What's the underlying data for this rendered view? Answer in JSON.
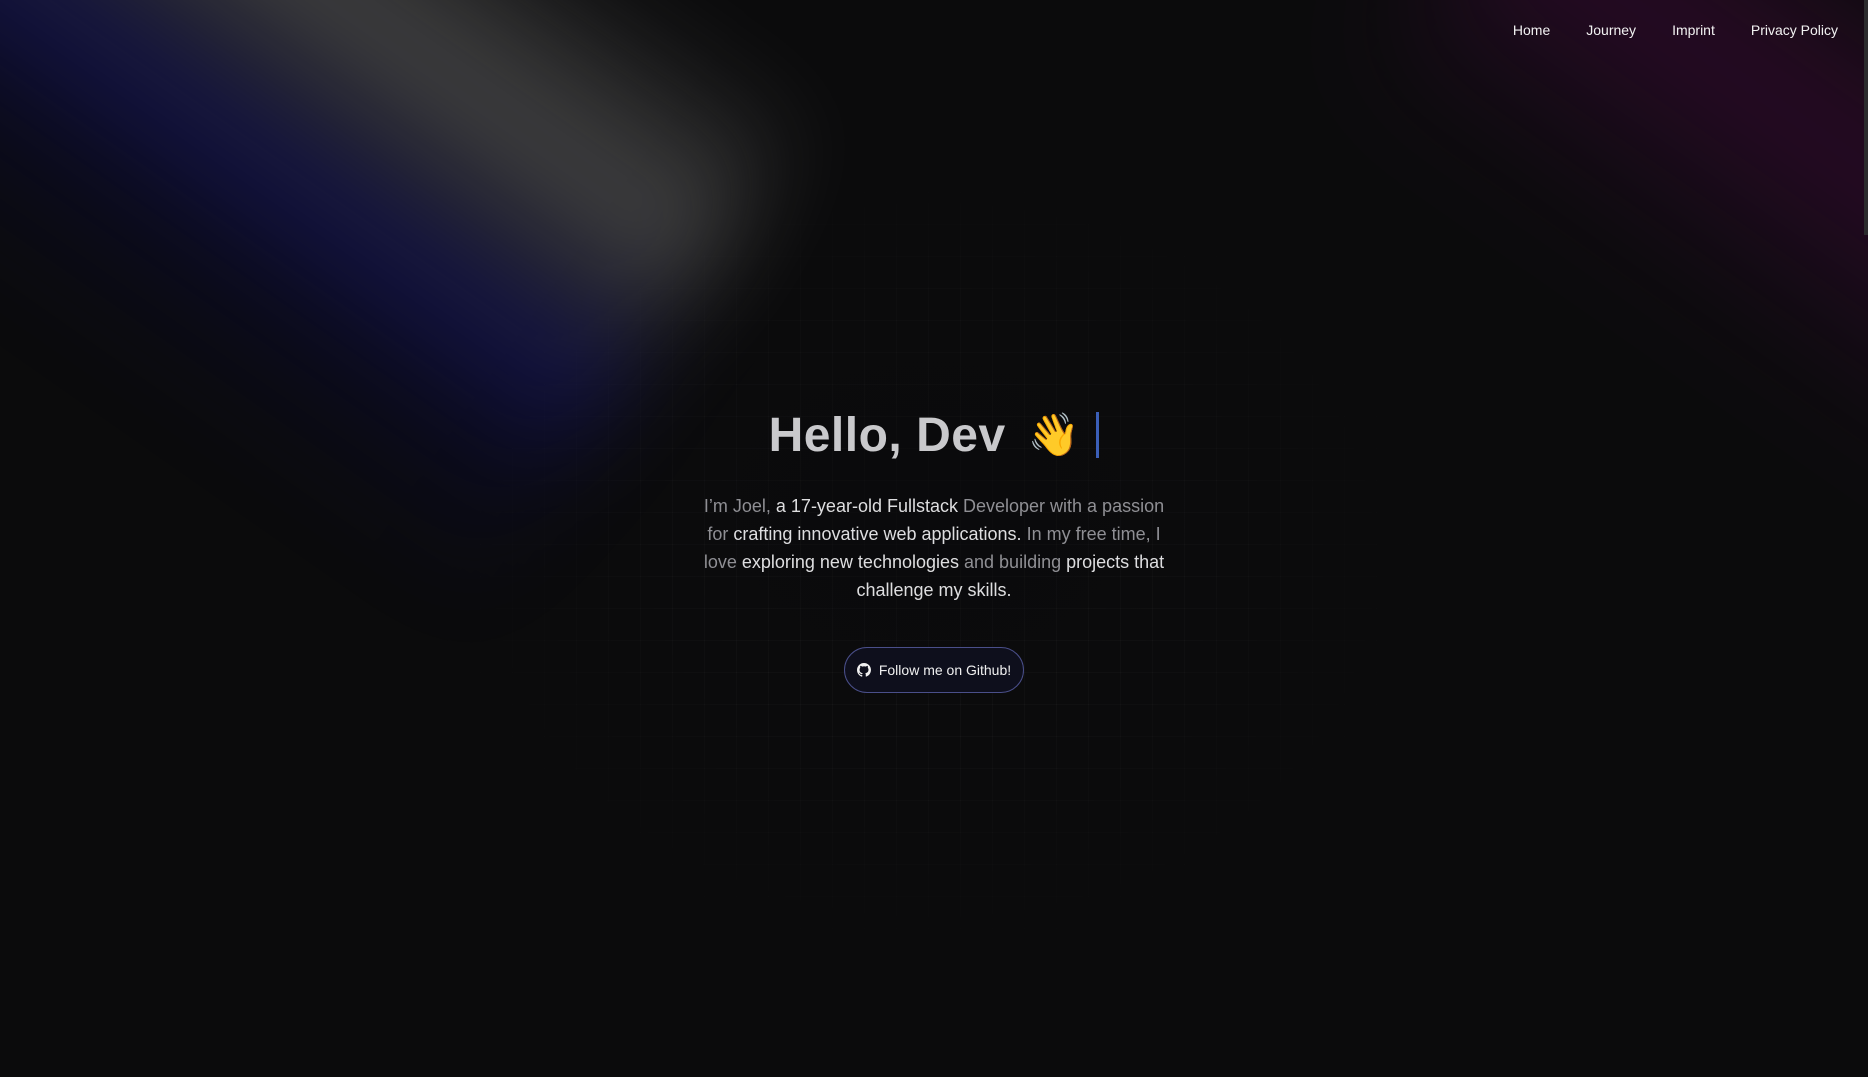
{
  "nav": {
    "items": [
      {
        "label": "Home"
      },
      {
        "label": "Journey"
      },
      {
        "label": "Imprint"
      },
      {
        "label": "Privacy Policy"
      }
    ]
  },
  "hero": {
    "headline": "Hello, Dev",
    "wave_emoji": "👋",
    "bio": [
      {
        "text": "I’m Joel, ",
        "highlight": false
      },
      {
        "text": "a 17-year-old Fullstack",
        "highlight": true
      },
      {
        "text": " Developer with a passion for ",
        "highlight": false
      },
      {
        "text": "crafting innovative web applications.",
        "highlight": true
      },
      {
        "text": " In my free time, I love ",
        "highlight": false
      },
      {
        "text": "exploring new technologies",
        "highlight": true
      },
      {
        "text": " and building ",
        "highlight": false
      },
      {
        "text": "projects that challenge my skills.",
        "highlight": true
      }
    ],
    "cta_label": "Follow me on Github!",
    "cta_icon": "github-icon"
  },
  "colors": {
    "background": "#0b0b0c",
    "headline": "#c9c9cc",
    "caret": "#3b5fb8",
    "button_border": "#4a4f8a"
  }
}
